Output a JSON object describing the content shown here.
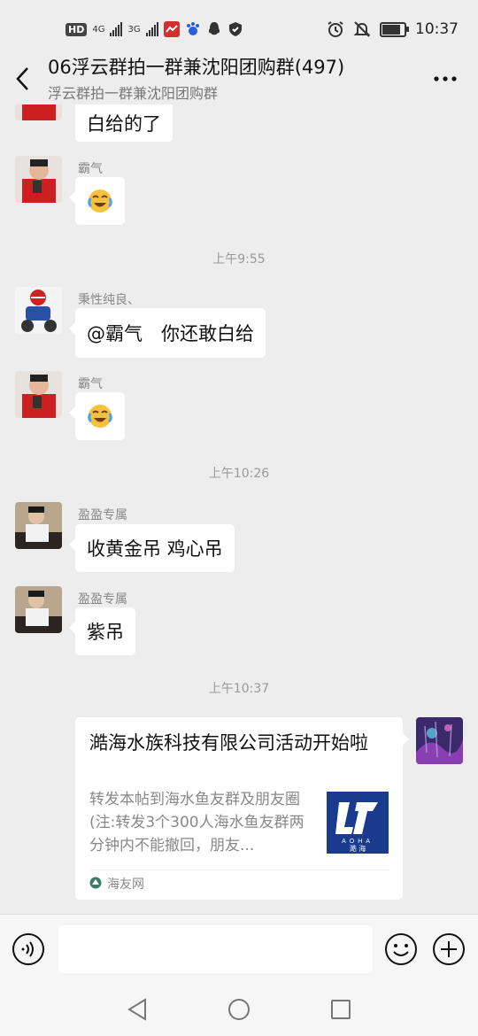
{
  "status_bar": {
    "hd_badge": "HD",
    "network_1": "4G",
    "network_2": "3G",
    "time": "10:37",
    "battery_level": 0.75
  },
  "header": {
    "title": "06浮云群拍一群兼沈阳团购群(497)",
    "subtitle": "浮云群拍一群兼沈阳团购群"
  },
  "messages": [
    {
      "type": "text",
      "sender": "",
      "text": "白给的了"
    },
    {
      "type": "emoji",
      "sender": "霸气",
      "emoji": "crying-laughing-emoji"
    },
    {
      "type": "time",
      "text": "上午9:55"
    },
    {
      "type": "text",
      "sender": "秉性纯良、",
      "text": "@霸气　你还敢白给"
    },
    {
      "type": "emoji",
      "sender": "霸气",
      "emoji": "crying-laughing-emoji"
    },
    {
      "type": "time",
      "text": "上午10:26"
    },
    {
      "type": "text",
      "sender": "盈盈专属",
      "text": "收黄金吊 鸡心吊"
    },
    {
      "type": "text",
      "sender": "盈盈专属",
      "text": "紫吊"
    },
    {
      "type": "time",
      "text": "上午10:37"
    }
  ],
  "share_card": {
    "title": "澔海水族科技有限公司活动开始啦",
    "description": "转发本帖到海水鱼友群及朋友圈(注:转发3个300人海水鱼友群两分钟内不能撤回，朋友...",
    "thumb_text_top": "AOHA",
    "thumb_text_bottom": "澔 海",
    "source": "海友网"
  },
  "input_bar": {
    "placeholder": ""
  },
  "colors": {
    "background": "#ededed",
    "bubble": "#ffffff",
    "timestamp": "#999999"
  }
}
